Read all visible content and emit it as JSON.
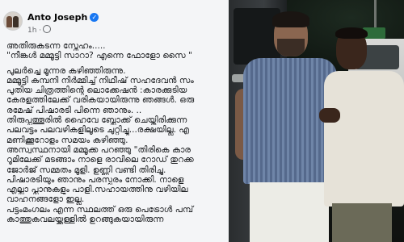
{
  "post": {
    "author": "Anto Joseph",
    "meta": "1h ·",
    "lines": [
      "അതിരുകടന്ന സ്നേഹം.....",
      "\"നീങ്കൾ മമ്മൂട്ടി സാറാ? എന്നെ ഫോളോ സൈ \"",
      "",
      "പുലർച്ചെ മൂന്നര കഴിഞ്ഞിരുന്നു.",
      "മമ്മൂട്ടി കമ്പനി നിർമ്മിച്ച് നിഥീഷ് സഹദേവൻ സം",
      "പുതിയ ചിത്രത്തിന്റെ ലൊക്കേഷൻ :കാരക്കുടിയ",
      "കേരളത്തിലേക്ക് വരികയായിരുന്നു ഞങ്ങൾ. ഒരു",
      "രമേഷ് പിഷാരടി പിന്നെ ഞാനും. ..",
      "തിരുപ്പത്തൂരിൽ ഹൈവേ ബ്ലോക്ക് ചെയ്തിരിക്കുന്ന",
      "പലവട്ടം പലവഴികളിലൂടെ ചുറ്റിച്ചു...രക്ഷയില്ല. എ",
      "മണിക്കൂറോളം സമയം കഴിഞ്ഞു.",
      "അസ്വസ്ഥനായി മമ്മൂക്ക പറഞ്ഞു \"തിരികെ കാര",
      "റൂമിലേക്ക് മടങ്ങാം നാളെ രാവിലെ റോഡ് തുറക്ക",
      "ജോർജ് സമ്മതം മൂളി. ഉണ്ണി വണ്ടി തിരിച്ചു.",
      "പിഷാരടിയും ഞാനും പരസ്പരം നോക്കി. നാളെ",
      "എല്ലാ പ്ലാനുകളും പാളി.സഹായത്തിനു വഴിയില",
      "വാഹനങ്ങളോ ഇല്ല.",
      "പട്ടംമംഗലം എന്ന സ്ഥലത്ത് ഒരു പെട്രോൾ പമ്പ്",
      "കാത്തുകവലയ്ക്കുള്ളിൽ ഉറങ്ങുകയായിരുന്ന"
    ]
  },
  "photo": {
    "subject": "mammootty-with-fan"
  }
}
